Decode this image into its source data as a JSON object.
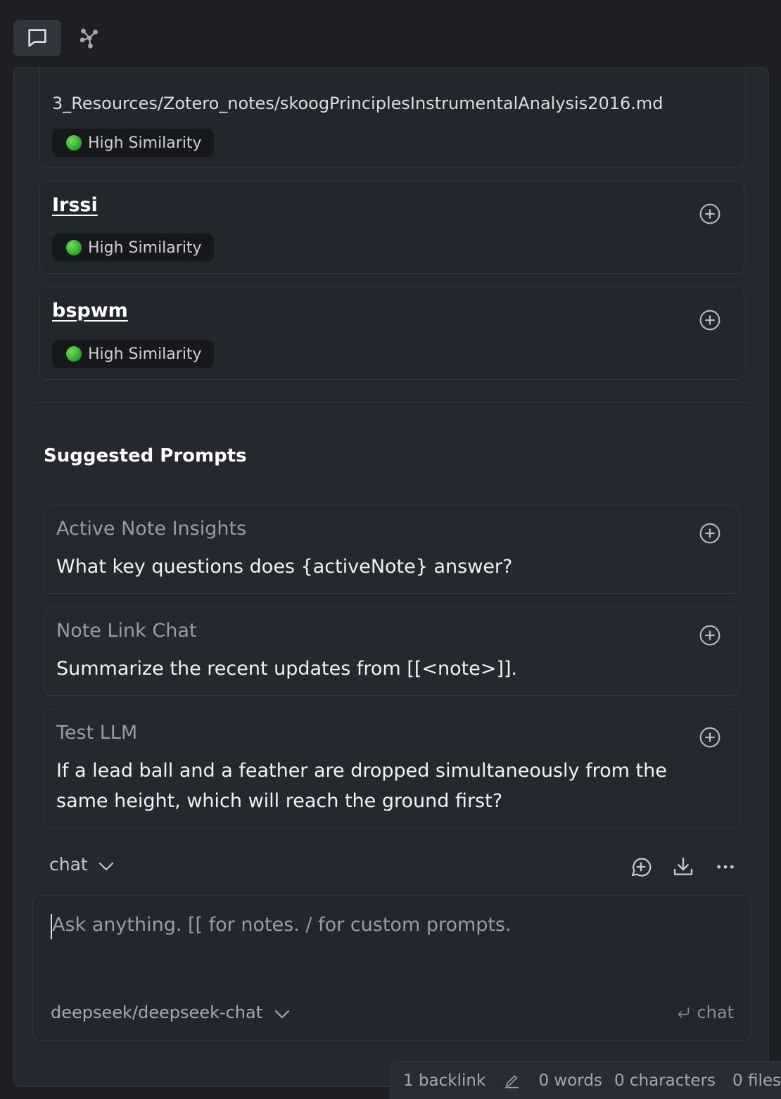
{
  "tabs": [
    {
      "name": "chat",
      "icon": "message-square-icon",
      "active": true
    },
    {
      "name": "relevant-notes",
      "icon": "graph-icon",
      "active": false
    }
  ],
  "relevant_notes": [
    {
      "path": "3_Resources/Zotero_notes/skoogPrinciplesInstrumentalAnalysis2016.md",
      "similarity": "High Similarity"
    },
    {
      "title": "Irssi",
      "similarity": "High Similarity"
    },
    {
      "title": "bspwm",
      "similarity": "High Similarity"
    }
  ],
  "suggested_prompts": {
    "heading": "Suggested Prompts",
    "items": [
      {
        "title": "Active Note Insights",
        "text": "What key questions does {activeNote} answer?"
      },
      {
        "title": "Note Link Chat",
        "text": "Summarize the recent updates from [[<note>]]."
      },
      {
        "title": "Test LLM",
        "text": "If a lead ball and a feather are dropped simultaneously from the same height, which will reach the ground first?"
      }
    ]
  },
  "chat_toolbar": {
    "mode": "chat",
    "icons": [
      "new-chat-icon",
      "download-icon",
      "more-icon"
    ]
  },
  "input": {
    "placeholder": "Ask anything. [[ for notes. / for custom prompts.",
    "model": "deepseek/deepseek-chat",
    "send_label": "chat"
  },
  "status_bar": {
    "backlinks": "1 backlink",
    "words": "0 words",
    "characters": "0 characters",
    "files": "0 files"
  },
  "colors": {
    "background": "#1e1f24",
    "panel": "#262830",
    "badge_dot": "#3cc13a"
  }
}
